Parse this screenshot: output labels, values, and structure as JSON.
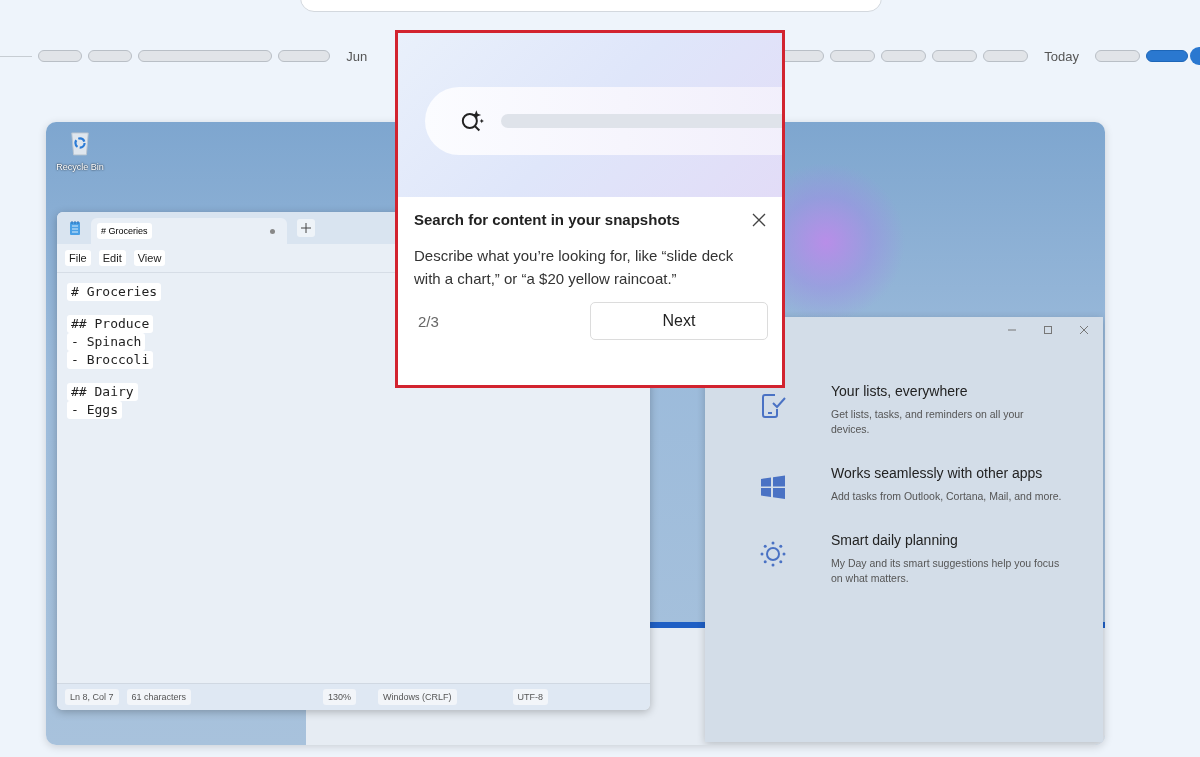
{
  "timeline": {
    "labels": [
      "Jun",
      "Today"
    ]
  },
  "desktop": {
    "icons": [
      {
        "label": "Recycle Bin"
      }
    ]
  },
  "notepad": {
    "tabs": [
      {
        "label": "# Groceries",
        "selected": true,
        "modified": true
      }
    ],
    "menu": [
      "File",
      "Edit",
      "View"
    ],
    "blocks": [
      [
        "# Groceries"
      ],
      [
        "## Produce",
        "- Spinach",
        "- Broccoli"
      ],
      [
        "## Dairy",
        "- Eggs"
      ]
    ],
    "status_bar": [
      "Ln 8, Col 7",
      "61 characters",
      "130%",
      "Windows (CRLF)",
      "UTF-8"
    ]
  },
  "todo": {
    "features": [
      {
        "kind": "phone-check",
        "title": "Your lists, everywhere",
        "description": "Get lists, tasks, and reminders on all your devices."
      },
      {
        "kind": "windows",
        "title": "Works seamlessly with other apps",
        "description": "Add tasks from Outlook, Cortana, Mail, and more."
      },
      {
        "kind": "sun",
        "title": "Smart daily planning",
        "description": "My Day and its smart suggestions help you focus on what matters."
      }
    ]
  },
  "teaching_tip": {
    "title": "Search for content in your snapshots",
    "body": "Describe what you’re looking for, like “slide deck with a chart,” or “a $20 yellow raincoat.”",
    "step": "2/3",
    "button": "Next"
  }
}
